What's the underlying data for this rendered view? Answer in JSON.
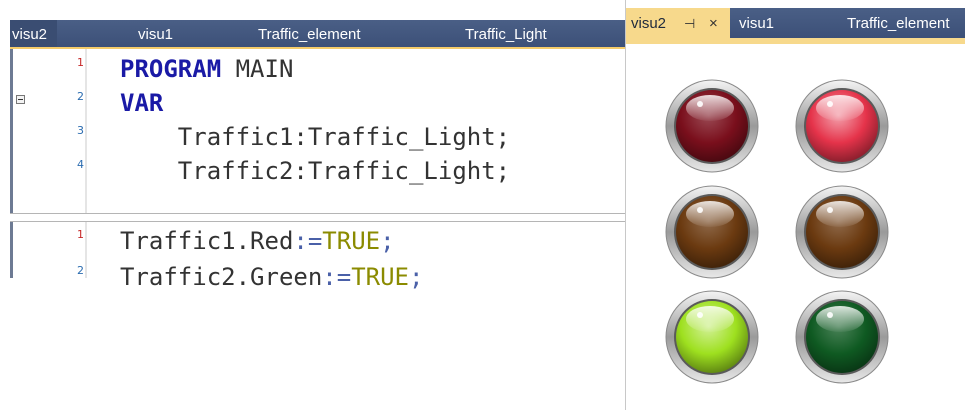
{
  "editor": {
    "tabs": [
      {
        "label": "visu2"
      },
      {
        "label": "visu1"
      },
      {
        "label": "Traffic_element"
      },
      {
        "label": "Traffic_Light"
      }
    ],
    "declaration": {
      "line_numbers": [
        "1",
        "2",
        "3",
        "4"
      ],
      "line1": {
        "kw": "PROGRAM",
        "rest": " MAIN"
      },
      "line2": {
        "kw": "VAR"
      },
      "line3": "    Traffic1:Traffic_Light;",
      "line4": "    Traffic2:Traffic_Light;"
    },
    "implementation": {
      "line_numbers": [
        "1",
        "2"
      ],
      "line1": {
        "lhs": "Traffic1.Red",
        "op": ":=",
        "val": "TRUE",
        "end": ";"
      },
      "line2": {
        "lhs": "Traffic2.Green",
        "op": ":=",
        "val": "TRUE",
        "end": ";"
      }
    }
  },
  "visu": {
    "tabs": [
      {
        "label": "visu2",
        "pin": "⊣",
        "close": "×"
      },
      {
        "label": "visu1"
      },
      {
        "label": "Traffic_element"
      }
    ],
    "lamps": [
      {
        "name": "traffic1-red-lamp",
        "state": "off",
        "color": "#7a0f1c"
      },
      {
        "name": "traffic2-red-lamp",
        "state": "on",
        "color": "#e5334a"
      },
      {
        "name": "traffic1-yellow-lamp",
        "state": "off",
        "color": "#6b3a10"
      },
      {
        "name": "traffic2-yellow-lamp",
        "state": "off",
        "color": "#6b3a10"
      },
      {
        "name": "traffic1-green-lamp",
        "state": "on",
        "color": "#9ee01f"
      },
      {
        "name": "traffic2-green-lamp",
        "state": "off",
        "color": "#0f5a22"
      }
    ]
  }
}
